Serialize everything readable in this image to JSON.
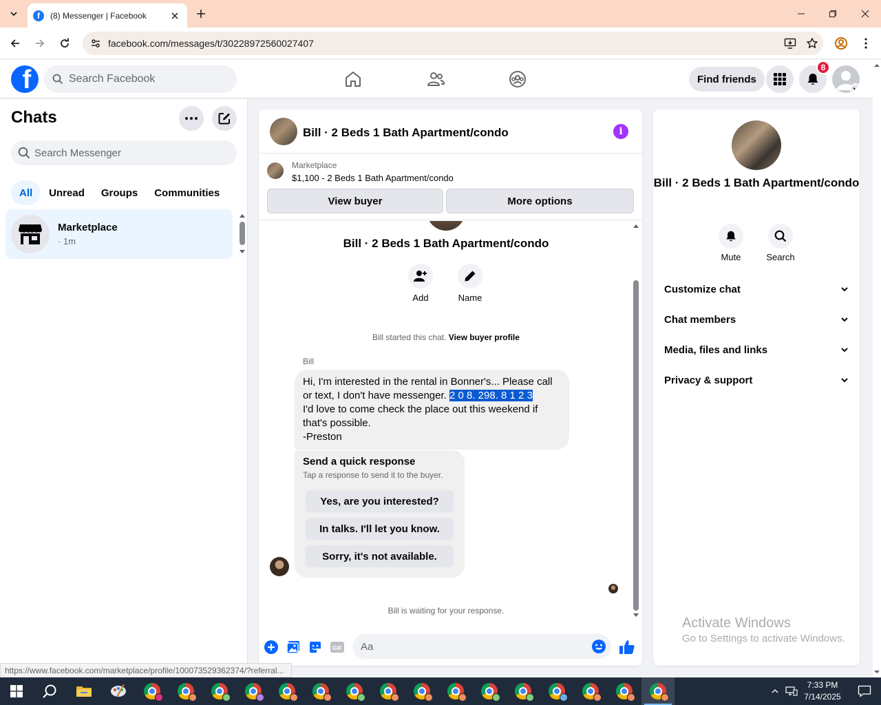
{
  "browser": {
    "tab_title": "(8) Messenger | Facebook",
    "url": "facebook.com/messages/t/30228972560027407",
    "status_url": "https://www.facebook.com/marketplace/profile/100073529362374/?referral..."
  },
  "fb": {
    "search_placeholder": "Search Facebook",
    "find_friends": "Find friends",
    "notif_count": "8"
  },
  "sidebar": {
    "title": "Chats",
    "search_placeholder": "Search Messenger",
    "filters": [
      "All",
      "Unread",
      "Groups",
      "Communities"
    ],
    "chat": {
      "name": "Marketplace",
      "meta": "· 1m"
    }
  },
  "conversation": {
    "title": "Bill · 2 Beds 1 Bath Apartment/condo",
    "listing_category": "Marketplace",
    "listing_title": "$1,100 - 2 Beds 1 Bath Apartment/condo",
    "view_buyer": "View buyer",
    "more_options": "More options",
    "actions": {
      "add": "Add",
      "name": "Name"
    },
    "started_text": "Bill started this chat.",
    "view_buyer_profile": "View buyer profile",
    "sender": "Bill",
    "message": {
      "line1": "Hi, I'm interested in the rental in Bonner's... Please call or text, I don't have messenger. ",
      "highlighted": "2 0 8. 298. 8 1 2 3",
      "line2": "I'd love to come check the place out this weekend if that's possible.",
      "line3": "-Preston"
    },
    "quick": {
      "title": "Send a quick response",
      "subtitle": "Tap a response to send it to the buyer.",
      "options": [
        "Yes, are you interested?",
        "In talks. I'll let you know.",
        "Sorry, it's not available."
      ]
    },
    "waiting": "Bill is waiting for your response.",
    "composer_placeholder": "Aa"
  },
  "info": {
    "name": "Bill · 2 Beds 1 Bath Apartment/condo",
    "mute": "Mute",
    "search": "Search",
    "sections": [
      "Customize chat",
      "Chat members",
      "Media, files and links",
      "Privacy & support"
    ]
  },
  "watermark": {
    "line1": "Activate Windows",
    "line2": "Go to Settings to activate Windows."
  },
  "taskbar": {
    "time": "7:33 PM",
    "date": "7/14/2025"
  },
  "colors": {
    "fb_blue": "#0866ff",
    "messenger_purple": "#a033ff",
    "notif_red": "#e41e3f",
    "selection_blue": "#0a5bd3",
    "chrome_tabstrip": "#fbd9c6"
  }
}
